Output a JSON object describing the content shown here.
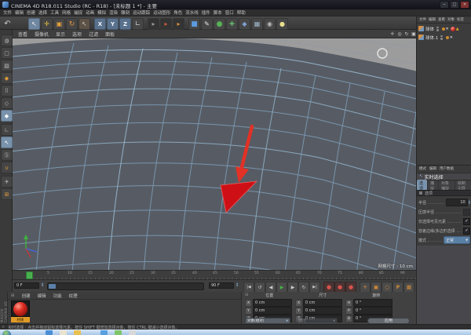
{
  "window": {
    "title": "CINEMA 4D R18.011 Studio (RC - R18) - [未标题 1 *] - 主要"
  },
  "menu_bar": {
    "items": [
      "文件",
      "编辑",
      "创建",
      "选择",
      "工具",
      "网格",
      "捕捉",
      "动画",
      "模拟",
      "渲染",
      "雕刻",
      "运动跟踪",
      "运动图形",
      "角色",
      "流水线",
      "插件",
      "脚本",
      "窗口",
      "帮助"
    ]
  },
  "toolbar": {
    "axis_buttons": [
      "X",
      "Y",
      "Z"
    ]
  },
  "viewport": {
    "menu": [
      "查看",
      "摄像机",
      "显示",
      "选项",
      "过滤",
      "面板"
    ],
    "grid_size_label": "网格尺寸 : 10 cm"
  },
  "timeline": {
    "ticks": [
      "5",
      "10",
      "15",
      "20",
      "25",
      "30",
      "35",
      "40",
      "45",
      "50",
      "55",
      "60",
      "65",
      "70",
      "75",
      "80",
      "85",
      "90"
    ],
    "current_frame": "0 F",
    "end_frame": "90 F"
  },
  "materials": {
    "brand": "MAXON CINEMA 4D",
    "menu": [
      "创建",
      "编辑",
      "功能",
      "纹理"
    ],
    "material_name": "材质"
  },
  "coordinates": {
    "headers": [
      "位置",
      "尺寸",
      "旋转"
    ],
    "pos_rows": [
      {
        "axis": "X",
        "value": "0 cm"
      },
      {
        "axis": "Y",
        "value": "0 cm"
      },
      {
        "axis": "Z",
        "value": "0 cm"
      }
    ],
    "size_rows": [
      {
        "axis": "X",
        "value": "0 cm"
      },
      {
        "axis": "Y",
        "value": "0 cm"
      },
      {
        "axis": "Z",
        "value": "0 cm"
      }
    ],
    "rot_rows": [
      {
        "axis": "H",
        "value": "0 °"
      },
      {
        "axis": "P",
        "value": "0 °"
      },
      {
        "axis": "B",
        "value": "0 °"
      }
    ],
    "mode_dropdown": "对象(相对)",
    "size_dropdown": "尺寸",
    "apply_button": "应用"
  },
  "object_manager": {
    "menu": [
      "文件",
      "编辑",
      "查看",
      "对象",
      "标签"
    ],
    "objects": [
      {
        "name": "球体"
      },
      {
        "name": "球体.1"
      }
    ]
  },
  "attributes": {
    "top_tabs": [
      "模式",
      "编辑",
      "用户数据"
    ],
    "title": "实时选择",
    "tabs": [
      "选项",
      "捕捉",
      "对象捕捉",
      "绘制引导"
    ],
    "rows": {
      "radius_label": "半径",
      "radius_value": "10",
      "pressure_label": "压感半径",
      "visible_label": "仅选择可见元素",
      "tolerant_label": "容差边缘/多边形选择",
      "mode_label": "模式",
      "mode_value": "正常"
    }
  },
  "status_bar": {
    "text": "实时选择 : 点击并拖动鼠标选择元素。按住 SHIFT 键增加选择对象，按住 CTRL 键减小选择对象。"
  },
  "icons": {
    "undo": "↶",
    "cursor": "↖",
    "move": "✛",
    "scale": "▣",
    "rotate": "↻",
    "corner": "∟",
    "render": "▸",
    "cube": "■",
    "pen": "✎",
    "sphere": "●",
    "generator": "✚",
    "deformer": "◆",
    "floor": "▦",
    "camera": "◉",
    "light": "●",
    "pan": "✛",
    "zoom_nav": "◎",
    "toggle": "▣",
    "to_start": "|◀",
    "loop_ccw": "↺",
    "prev": "◀",
    "play": "▶",
    "next": "▶",
    "loop": "↻",
    "to_end": "▶|",
    "record": "●",
    "key_pos": "✛",
    "key_scale": "▣",
    "key_rot": "○",
    "key_param": "P",
    "key_pla": "▦",
    "solo": "▮",
    "dropdown": "▼",
    "spin_up": "▲",
    "spin_down": "▼",
    "check": "✓",
    "cross": "✕",
    "warning": "▲",
    "grid_btn": "⊞",
    "grip": "≡",
    "minimize": "─",
    "maximize": "□",
    "close": "✕",
    "editable": "◍",
    "model": "▢",
    "texture": "▨",
    "workplane": "◆",
    "points": "⠿",
    "edges": "◇",
    "polygons": "◆",
    "axis_mode": "∟",
    "solo_view": "↖",
    "snap": "Ⓢ",
    "magnet": "∪",
    "quantize": "✈"
  },
  "colors": {
    "accent_blue": "#7a93ad",
    "wireframe": "#7e9db8",
    "selection_red": "#ce1016",
    "arrow_red": "#e23126",
    "material_red": "#c01616",
    "key_orange": "#dc9038",
    "record_red": "#d4534b",
    "play_green": "#45b545",
    "playhead_green": "#49b04f"
  }
}
